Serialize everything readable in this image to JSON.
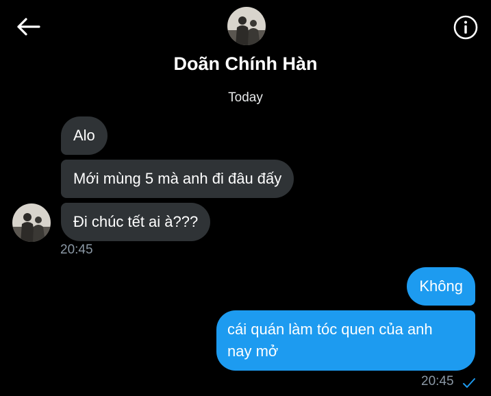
{
  "header": {
    "contact_name": "Doãn Chính Hàn",
    "date_label": "Today"
  },
  "icons": {
    "back": "back-arrow-icon",
    "info": "info-icon",
    "read_status": "check-icon"
  },
  "colors": {
    "background": "#000000",
    "incoming_bubble": "#2f3336",
    "outgoing_bubble": "#1d9bf0",
    "timestamp": "#8b98a5"
  },
  "incoming": {
    "messages": [
      "Alo",
      "Mới mùng 5 mà anh đi đâu đấy",
      "Đi chúc tết ai à???"
    ],
    "time": "20:45"
  },
  "outgoing": {
    "messages": [
      "Không",
      "cái quán làm tóc quen của anh nay mở"
    ],
    "time": "20:45"
  }
}
